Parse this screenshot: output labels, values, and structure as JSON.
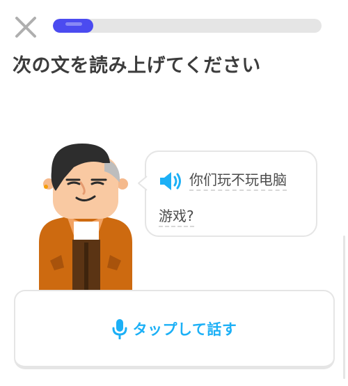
{
  "colors": {
    "progress": "#4b4bf0",
    "accent": "#1cb0f6",
    "track": "#e5e5e5",
    "text": "#3c3c3c"
  },
  "progress": {
    "fraction": 0.15
  },
  "prompt": "次の文を読み上げてください",
  "bubble": {
    "line1": "你们玩不玩电脑",
    "line2": "游戏?"
  },
  "tap_to_speak": "タップして話す",
  "icons": {
    "close": "close-icon",
    "speaker": "speaker-icon",
    "mic": "microphone-icon"
  }
}
